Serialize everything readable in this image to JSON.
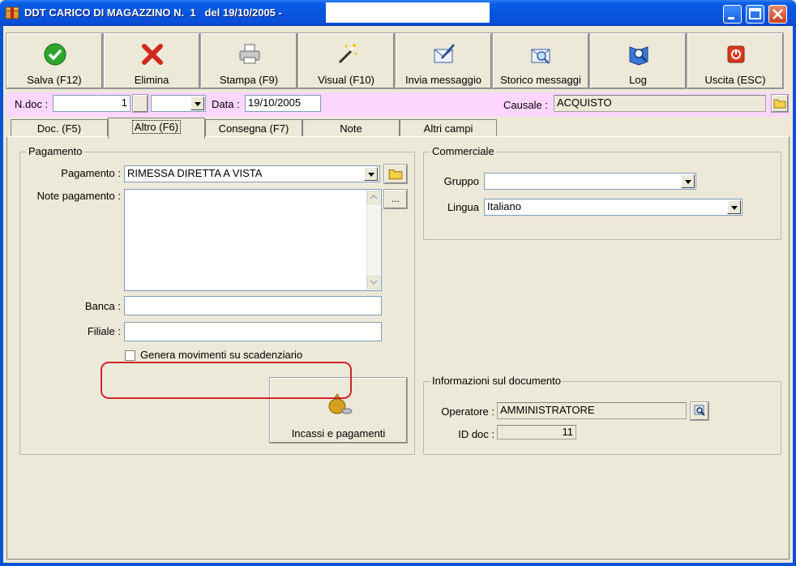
{
  "window": {
    "title": "DDT CARICO DI MAGAZZINO N.  1   del 19/10/2005 -",
    "min_icon": "minimize-icon",
    "max_icon": "maximize-icon",
    "close_icon": "close-icon"
  },
  "toolbar": {
    "save_label": "Salva (F12)",
    "delete_label": "Elimina",
    "print_label": "Stampa (F9)",
    "view_label": "Visual (F10)",
    "send_label": "Invia messaggio",
    "history_label": "Storico messaggi",
    "log_label": "Log",
    "exit_label": "Uscita (ESC)"
  },
  "header": {
    "ndoc_label": "N.doc :",
    "ndoc_value": "1",
    "data_label": "Data :",
    "data_value": "19/10/2005",
    "causale_label": "Causale :",
    "causale_value": "ACQUISTO"
  },
  "tabs": [
    {
      "label": "Doc. (F5)"
    },
    {
      "label": "Altro (F6)"
    },
    {
      "label": "Consegna (F7)"
    },
    {
      "label": "Note"
    },
    {
      "label": "Altri campi"
    }
  ],
  "pagamento": {
    "group_title": "Pagamento",
    "pagamento_label": "Pagamento :",
    "pagamento_value": "RIMESSA DIRETTA A VISTA",
    "note_label": "Note pagamento :",
    "note_btn": "...",
    "banca_label": "Banca :",
    "filiale_label": "Filiale :",
    "genera_label": "Genera movimenti su scadenziario",
    "incassi_label": "Incassi e pagamenti"
  },
  "commerciale": {
    "group_title": "Commerciale",
    "gruppo_label": "Gruppo",
    "lingua_label": "Lingua",
    "lingua_value": "Italiano"
  },
  "info": {
    "group_title": "Informazioni sul documento",
    "operatore_label": "Operatore :",
    "operatore_value": "AMMINISTRATORE",
    "iddoc_label": "ID doc :",
    "iddoc_value": "11"
  },
  "colors": {
    "titlebar": "#0655df",
    "pink_bar": "#ffd6ff",
    "annotation": "#d0242a"
  }
}
